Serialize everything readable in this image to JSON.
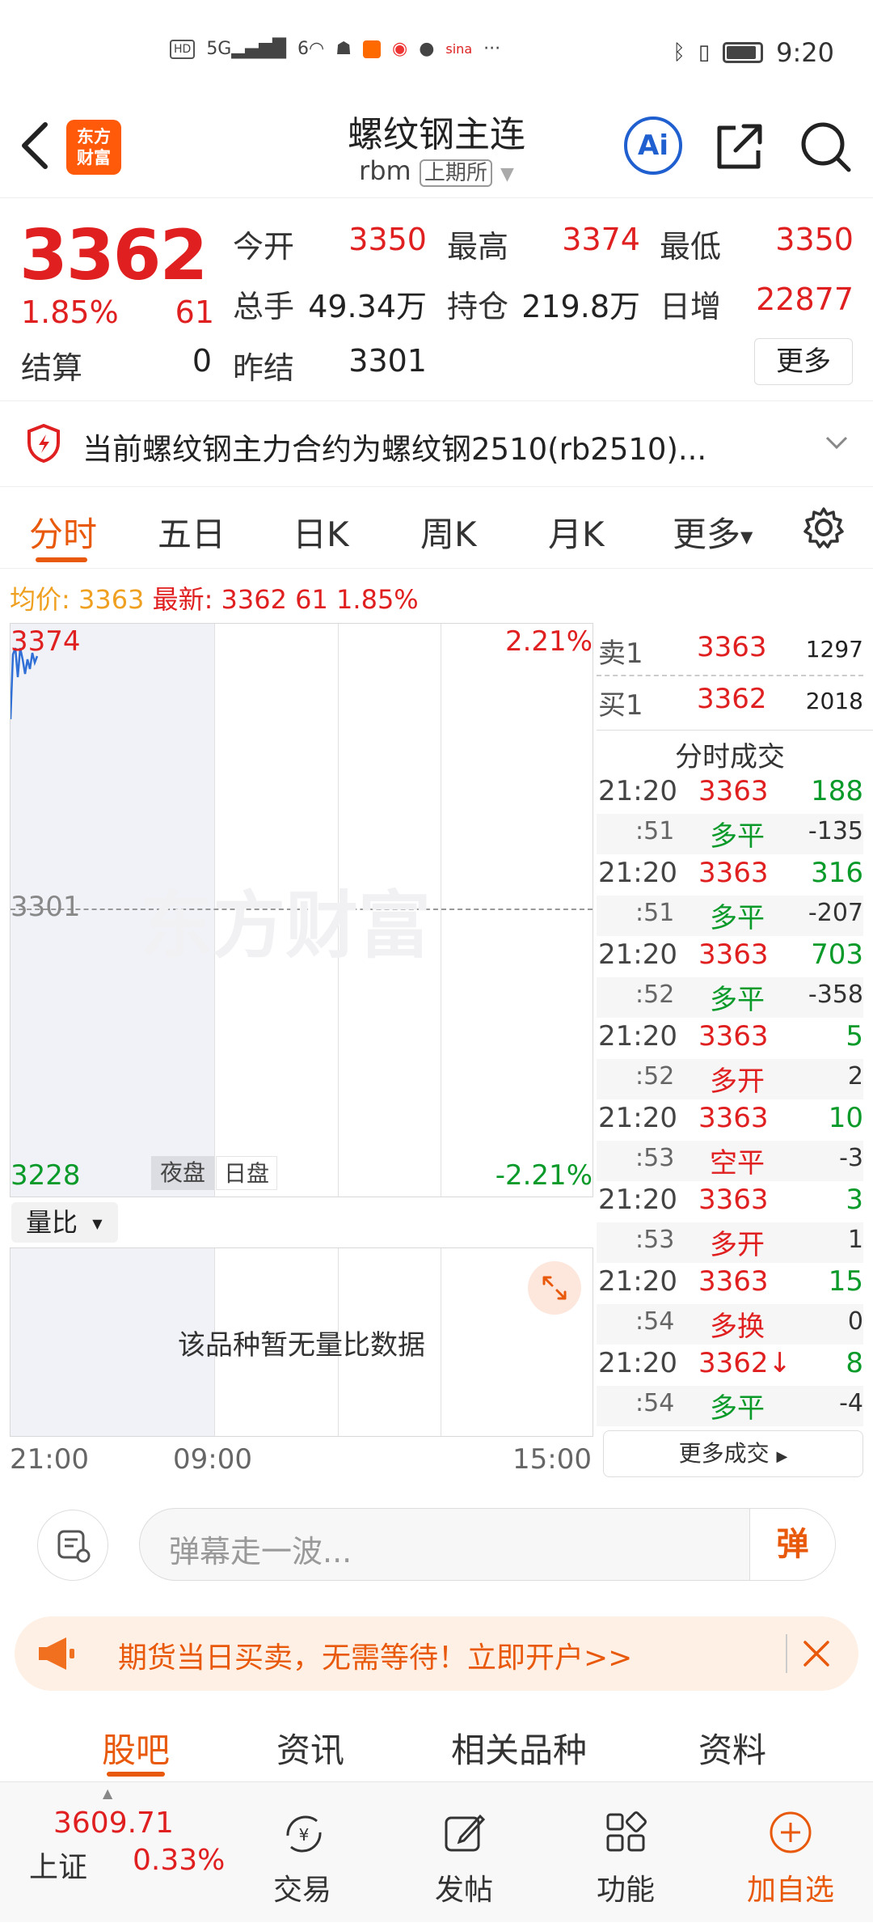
{
  "status": {
    "time": "9:20",
    "network": "5G",
    "sim_count": "6",
    "hd": "HD"
  },
  "header": {
    "title": "螺纹钢主连",
    "code": "rbm",
    "exchange": "上期所",
    "logo_line1": "东方",
    "logo_line2": "财富",
    "ai_label": "Ai"
  },
  "quote": {
    "price": "3362",
    "pct": "1.85%",
    "change": "61",
    "open_label": "今开",
    "open": "3350",
    "high_label": "最高",
    "high": "3374",
    "low_label": "最低",
    "low": "3350",
    "volume_label": "总手",
    "volume": "49.34万",
    "oi_label": "持仓",
    "oi": "219.8万",
    "daily_inc_label": "日增",
    "daily_inc": "22877",
    "settle_label": "结算",
    "settle": "0",
    "prev_settle_label": "昨结",
    "prev_settle": "3301",
    "more_label": "更多"
  },
  "notice": {
    "text": "当前螺纹钢主力合约为螺纹钢2510(rb2510)..."
  },
  "tabs": [
    "分时",
    "五日",
    "日K",
    "周K",
    "月K",
    "更多"
  ],
  "avg": {
    "avg_label": "均价:",
    "avg_value": "3363",
    "latest_label": "最新:",
    "latest_value": "3362",
    "change": "61",
    "pct": "1.85%"
  },
  "chart": {
    "y_top": "3374",
    "y_mid": "3301",
    "y_bottom": "3228",
    "pct_top": "2.21%",
    "pct_bottom": "-2.21%",
    "session_night": "夜盘",
    "session_day": "日盘",
    "x_labels": [
      "21:00",
      "09:00",
      "15:00"
    ],
    "watermark": "东方财富"
  },
  "volume": {
    "selector": "量比",
    "empty_text": "该品种暂无量比数据"
  },
  "orderbook": {
    "ask_label": "卖1",
    "ask_price": "3363",
    "ask_vol": "1297",
    "bid_label": "买1",
    "bid_price": "3362",
    "bid_vol": "2018"
  },
  "trades_title": "分时成交",
  "trades": [
    {
      "time": "21:20",
      "price": "3363",
      "vol": "188",
      "sec": ":51",
      "type": "多平",
      "type_color": "green",
      "oi": "-135"
    },
    {
      "time": "21:20",
      "price": "3363",
      "vol": "316",
      "sec": ":51",
      "type": "多平",
      "type_color": "green",
      "oi": "-207"
    },
    {
      "time": "21:20",
      "price": "3363",
      "vol": "703",
      "sec": ":52",
      "type": "多平",
      "type_color": "green",
      "oi": "-358"
    },
    {
      "time": "21:20",
      "price": "3363",
      "vol": "5",
      "sec": ":52",
      "type": "多开",
      "type_color": "red",
      "oi": "2"
    },
    {
      "time": "21:20",
      "price": "3363",
      "vol": "10",
      "sec": ":53",
      "type": "空平",
      "type_color": "red",
      "oi": "-3"
    },
    {
      "time": "21:20",
      "price": "3363",
      "vol": "3",
      "sec": ":53",
      "type": "多开",
      "type_color": "red",
      "oi": "1"
    },
    {
      "time": "21:20",
      "price": "3363",
      "vol": "15",
      "sec": ":54",
      "type": "多换",
      "type_color": "red",
      "oi": "0"
    },
    {
      "time": "21:20",
      "price": "3362↓",
      "vol": "8",
      "sec": ":54",
      "type": "多平",
      "type_color": "green",
      "oi": "-4"
    }
  ],
  "more_trades": "更多成交",
  "chat": {
    "placeholder": "弹幕走一波...",
    "danmu": "弹"
  },
  "banner": {
    "text": "期货当日买卖，无需等待！立即开户>>"
  },
  "bottom_tabs": [
    "股吧",
    "资讯",
    "相关品种",
    "资料"
  ],
  "index": {
    "value": "3609.71",
    "name": "上证",
    "pct": "0.33%"
  },
  "nav": [
    "交易",
    "发帖",
    "功能",
    "加自选"
  ],
  "colors": {
    "up": "#e02020",
    "down": "#0a9a2a",
    "accent": "#e8590c",
    "avg": "#f0a020"
  }
}
